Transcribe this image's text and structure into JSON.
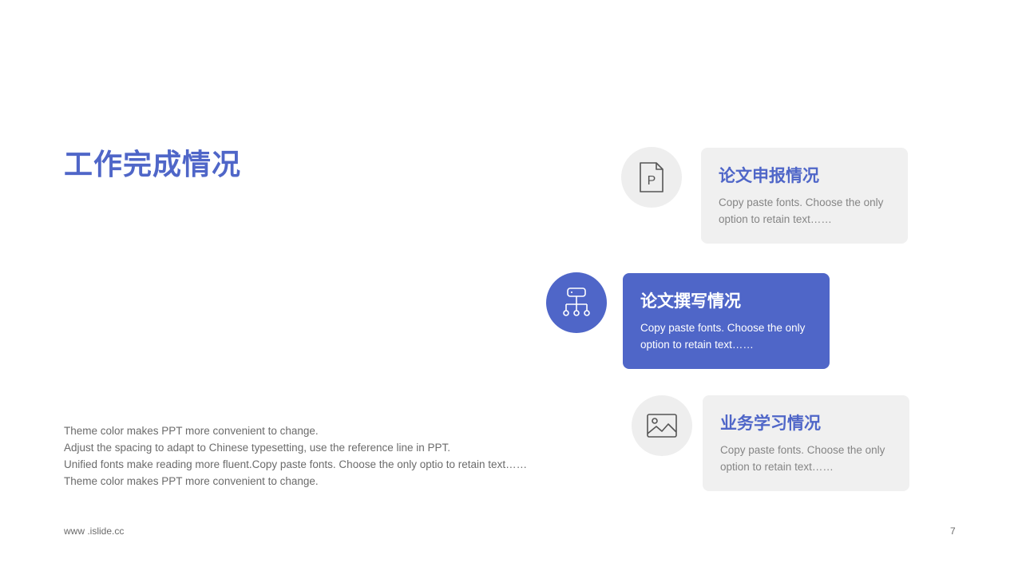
{
  "title": "工作完成情况",
  "body_lines": [
    "Theme  color makes PPT more convenient to change.",
    "Adjust the spacing to adapt to Chinese typesetting, use the reference line in PPT.",
    "Unified fonts make reading more fluent.Copy paste fonts. Choose the only optio to retain text……",
    "Theme   color makes PPT more convenient to change."
  ],
  "footer": {
    "url": "www .islide.cc",
    "page_number": "7"
  },
  "items": [
    {
      "icon": "document-p-icon",
      "title": "论文申报情况",
      "desc": "Copy paste fonts. Choose the only option to retain text……",
      "active": false
    },
    {
      "icon": "hierarchy-icon",
      "title": "论文撰写情况",
      "desc": "Copy paste fonts. Choose the only option to retain text……",
      "active": true
    },
    {
      "icon": "image-icon",
      "title": "业务学习情况",
      "desc": "Copy paste fonts. Choose the only option to retain text……",
      "active": false
    }
  ],
  "colors": {
    "accent": "#4F66C8",
    "card_bg": "#F0F0F0",
    "circle_bg": "#EEEEEE",
    "text_gray": "#6B6B6B"
  }
}
